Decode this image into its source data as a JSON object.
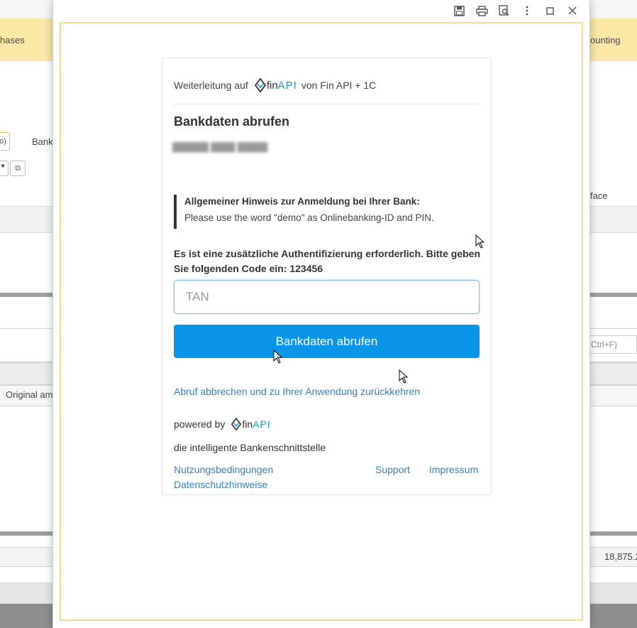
{
  "background": {
    "ribbon_tabs": [
      "hases",
      "ounting"
    ],
    "bank_label": "Bank",
    "left_button": "o)",
    "surface_label": "face",
    "column_header": "Original am",
    "search_hint": "Ctrl+F)",
    "amount": "18,875.2"
  },
  "window": {
    "toolbar": [
      "save-icon",
      "print-icon",
      "preview-icon",
      "more-icon",
      "maximize-icon",
      "close-icon"
    ]
  },
  "finapi": {
    "redirect_prefix": "Weiterleitung auf",
    "redirect_suffix": "von Fin API + 1C",
    "logo_fin": "fin",
    "logo_api": "API",
    "title": "Bankdaten abrufen",
    "notice_heading": "Allgemeiner Hinweis zur Anmeldung bei Ihrer Bank:",
    "notice_body": "Please use the word \"demo\" as Onlinebanking-ID and PIN.",
    "auth_text": "Es ist eine zusätzliche Authentifizierung erforderlich. Bitte geben Sie folgenden Code ein: 123456",
    "tan_placeholder": "TAN",
    "submit_label": "Bankdaten abrufen",
    "cancel_link": "Abruf abbrechen und zu Ihrer Anwendung zurückkehren",
    "powered_by": "powered by",
    "tagline": "die intelligente Bankenschnittstelle",
    "links": {
      "terms": "Nutzungsbedingungen",
      "privacy": "Datenschutzhinweise",
      "support": "Support",
      "imprint": "Impressum"
    },
    "colors": {
      "primary": "#0a96e8",
      "link": "#3a7fc1",
      "logo": "#1a9ad6"
    }
  }
}
